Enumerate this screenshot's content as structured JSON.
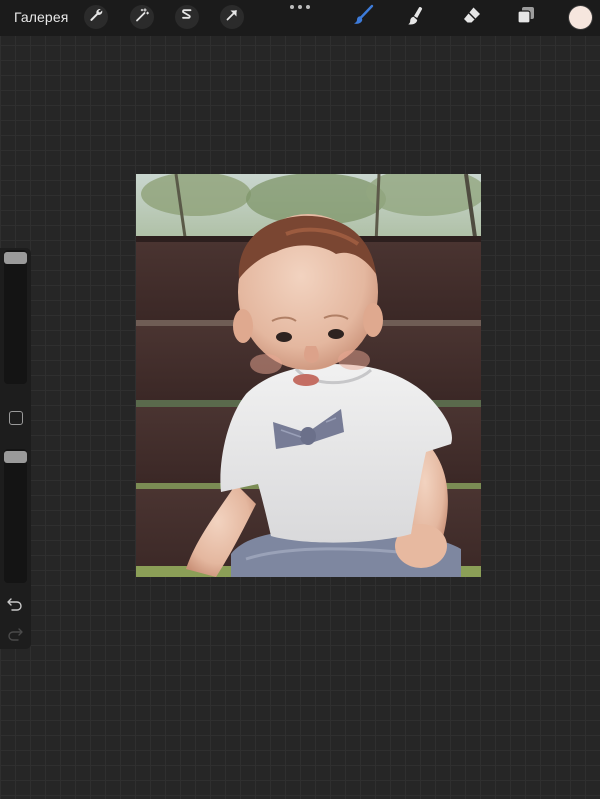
{
  "topbar": {
    "gallery_label": "Галерея",
    "left_tools": [
      {
        "icon": "wrench-icon",
        "name": "actions"
      },
      {
        "icon": "magic-wand-icon",
        "name": "adjustments"
      },
      {
        "icon": "selection-s-icon",
        "name": "selection"
      },
      {
        "icon": "arrow-cursor-icon",
        "name": "transform"
      }
    ],
    "right_tools": [
      {
        "icon": "brush-icon",
        "name": "paint",
        "active": true
      },
      {
        "icon": "smudge-icon",
        "name": "smudge",
        "active": false
      },
      {
        "icon": "eraser-icon",
        "name": "erase",
        "active": false
      },
      {
        "icon": "layers-icon",
        "name": "layers",
        "active": false
      }
    ],
    "current_color": "#f6e6de"
  },
  "sidebar": {
    "brush_size_thumb": "top",
    "opacity_thumb": "top",
    "undo_icon": "undo-icon",
    "redo_icon": "redo-icon"
  },
  "canvas": {
    "content": "photo"
  },
  "colors": {
    "accent": "#3d7bd9",
    "topbar_bg": "#1b1b1b",
    "canvas_bg": "#262626"
  }
}
